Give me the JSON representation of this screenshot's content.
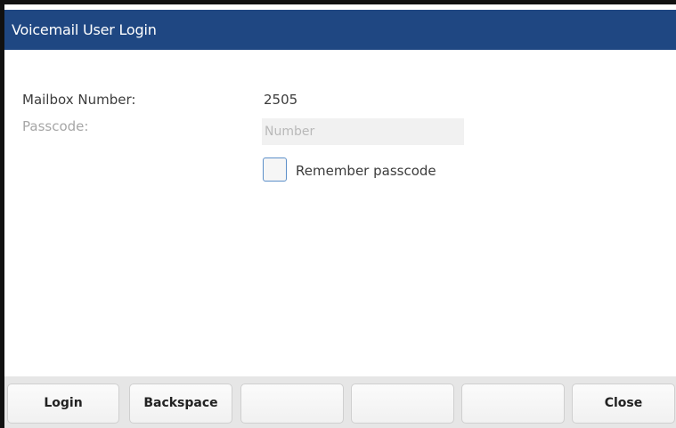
{
  "title_bar": {
    "title": "Voicemail User Login"
  },
  "form": {
    "mailbox_label": "Mailbox Number:",
    "mailbox_value": "2505",
    "passcode_label": "Passcode:",
    "passcode_value": "",
    "passcode_placeholder": "Number",
    "remember_label": "Remember passcode",
    "remember_checked": false
  },
  "softkeys": [
    {
      "label": "Login"
    },
    {
      "label": "Backspace"
    },
    {
      "label": ""
    },
    {
      "label": ""
    },
    {
      "label": ""
    },
    {
      "label": "Close"
    }
  ],
  "colors": {
    "title_bar_bg": "#1f4782",
    "title_text": "#ffffff",
    "muted_label": "#a6a6a6",
    "checkbox_border": "#5c8fc9",
    "softkey_bar_bg": "#e6e6e6"
  }
}
